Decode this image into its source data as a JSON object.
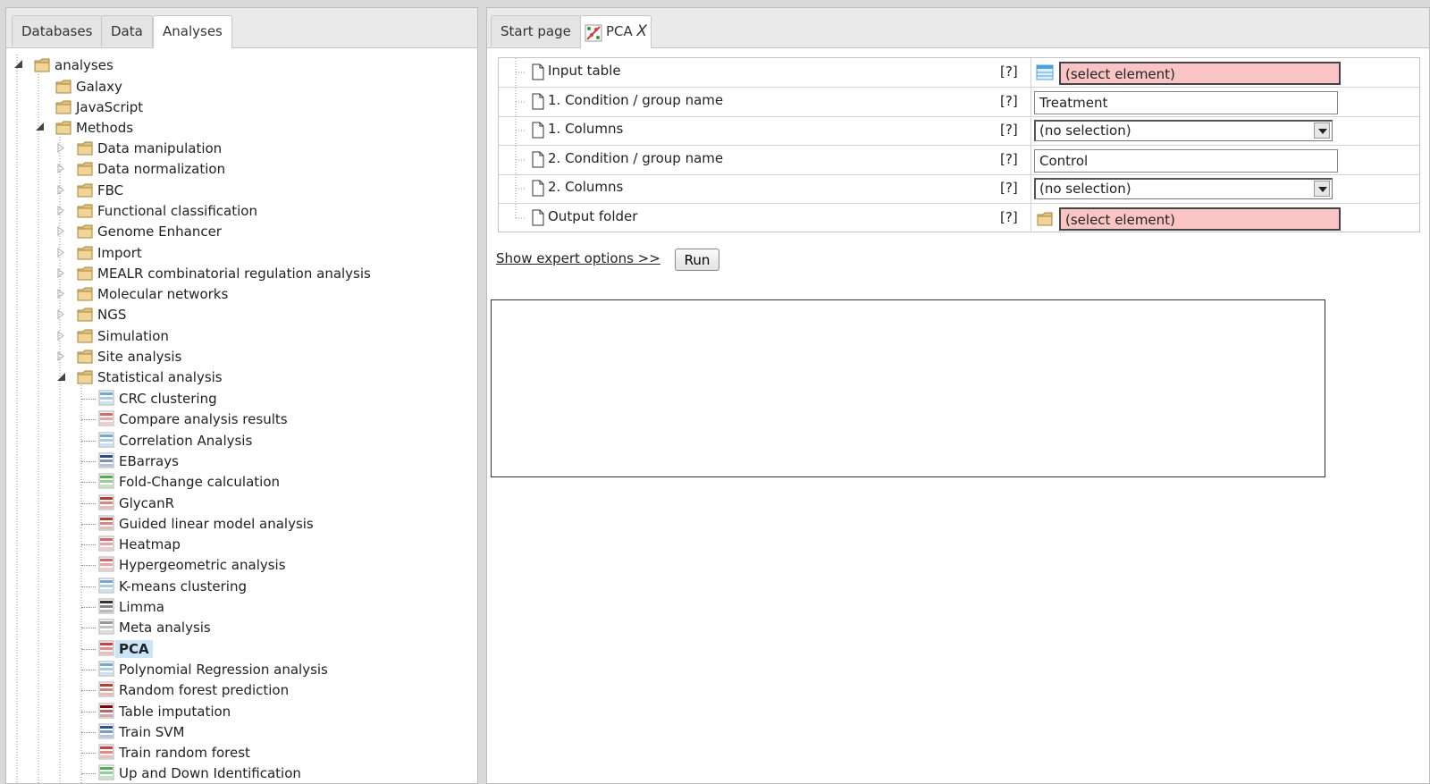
{
  "left_tabs": [
    "Databases",
    "Data",
    "Analyses"
  ],
  "tree": {
    "root": "analyses",
    "level1": [
      "Galaxy",
      "JavaScript",
      "Methods"
    ],
    "methods": [
      "Data manipulation",
      "Data normalization",
      "FBC",
      "Functional classification",
      "Genome Enhancer",
      "Import",
      "MEALR combinatorial regulation analysis",
      "Molecular networks",
      "NGS",
      "Simulation",
      "Site analysis",
      "Statistical analysis"
    ],
    "statistical": [
      "CRC clustering",
      "Compare analysis results",
      "Correlation Analysis",
      "EBarrays",
      "Fold-Change calculation",
      "GlycanR",
      "Guided linear model analysis",
      "Heatmap",
      "Hypergeometric analysis",
      "K-means clustering",
      "Limma",
      "Meta analysis",
      "PCA",
      "Polynomial Regression analysis",
      "Random forest prediction",
      "Table imputation",
      "Train SVM",
      "Train random forest",
      "Up and Down Identification"
    ],
    "selected": "PCA"
  },
  "right_tabs": {
    "start": "Start page",
    "pca": "PCA",
    "close": "X"
  },
  "form": {
    "help": "[?]",
    "rows": [
      {
        "name": "Input table",
        "value": "(select element)"
      },
      {
        "name": "1. Condition / group name",
        "value": "Treatment"
      },
      {
        "name": "1. Columns",
        "value": "(no selection)"
      },
      {
        "name": "2. Condition / group name",
        "value": "Control"
      },
      {
        "name": "2. Columns",
        "value": "(no selection)"
      },
      {
        "name": "Output folder",
        "value": "(select element)"
      }
    ]
  },
  "actions": {
    "expert": "Show expert options >>",
    "run": "Run"
  },
  "colors": {
    "error_field": "#fbc4c4",
    "selected_item": "#cbe6f8",
    "folder": "#e3c27a"
  }
}
